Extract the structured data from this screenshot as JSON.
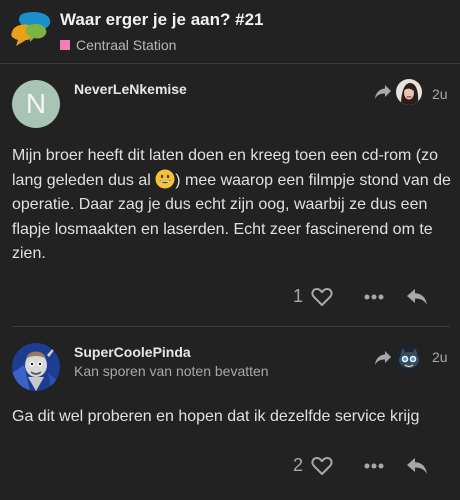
{
  "topic": {
    "title": "Waar erger je je aan? #21",
    "category": "Centraal Station",
    "category_color": "#f57eb6"
  },
  "posts": [
    {
      "username": "NeverLeNkemise",
      "avatar_letter": "N",
      "avatar_color": "#a7c4b5",
      "age": "2u",
      "body_before_emoji": "Mijn broer heeft dit laten doen en kreeg toen een cd-rom (zo lang geleden dus al ",
      "body_after_emoji": ") mee waarop een filmpje stond van de operatie. Daar zag je dus echt zijn oog, waarbij ze dus een flapje losmaakten en laserden. Echt zeer fascinerend om te zien.",
      "likes": "1"
    },
    {
      "username": "SuperCoolePinda",
      "user_title": "Kan sporen van noten bevatten",
      "age": "2u",
      "body": "Ga dit wel proberen en hopen dat ik dezelfde service krijg",
      "likes": "2"
    }
  ],
  "icons": {
    "reply_to": "share-arrow-icon",
    "like": "heart-outline-icon",
    "more": "ellipsis-icon",
    "reply": "reply-arrow-icon"
  }
}
